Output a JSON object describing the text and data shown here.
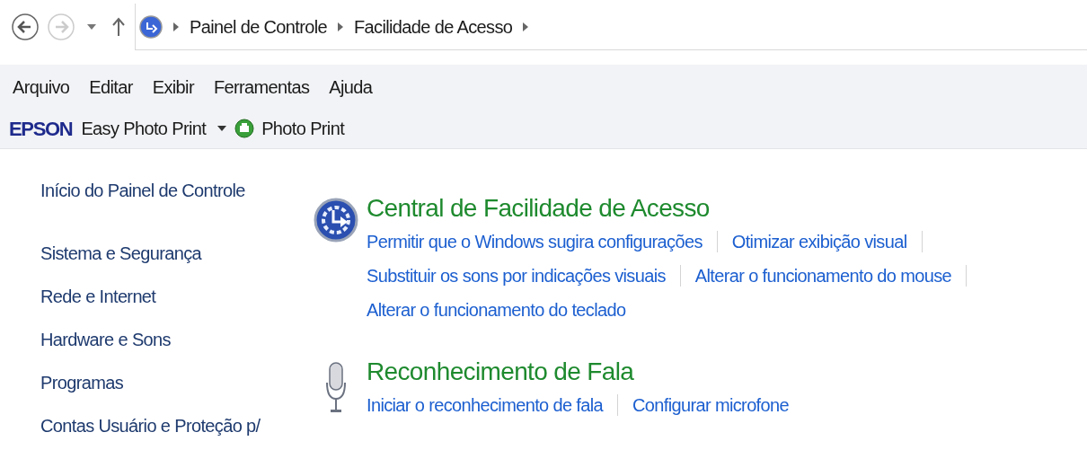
{
  "address_bar": {
    "breadcrumbs": [
      "Painel de Controle",
      "Facilidade de Acesso"
    ]
  },
  "menu_bar": [
    "Arquivo",
    "Editar",
    "Exibir",
    "Ferramentas",
    "Ajuda"
  ],
  "toolbar": {
    "brand": "EPSON",
    "dropdown": "Easy Photo Print",
    "button": "Photo Print"
  },
  "sidebar": {
    "items": [
      {
        "label": "Início do Painel de Controle",
        "kind": "home"
      },
      {
        "label": "Sistema e Segurança",
        "kind": "category"
      },
      {
        "label": "Rede e Internet",
        "kind": "category"
      },
      {
        "label": "Hardware e Sons",
        "kind": "category"
      },
      {
        "label": "Programas",
        "kind": "category"
      },
      {
        "label": "Contas Usuário e Proteção p/",
        "kind": "category"
      }
    ]
  },
  "sections": [
    {
      "kind": "access",
      "title": "Central de Facilidade de Acesso",
      "link_rows": [
        [
          "Permitir que o Windows sugira configurações",
          "Otimizar exibição visual"
        ],
        [
          "Substituir os sons por indicações visuais",
          "Alterar o funcionamento do mouse"
        ],
        [
          "Alterar o funcionamento do teclado"
        ]
      ]
    },
    {
      "kind": "speech",
      "title": "Reconhecimento de Fala",
      "link_rows": [
        [
          "Iniciar o reconhecimento de fala",
          "Configurar microfone"
        ]
      ]
    }
  ]
}
